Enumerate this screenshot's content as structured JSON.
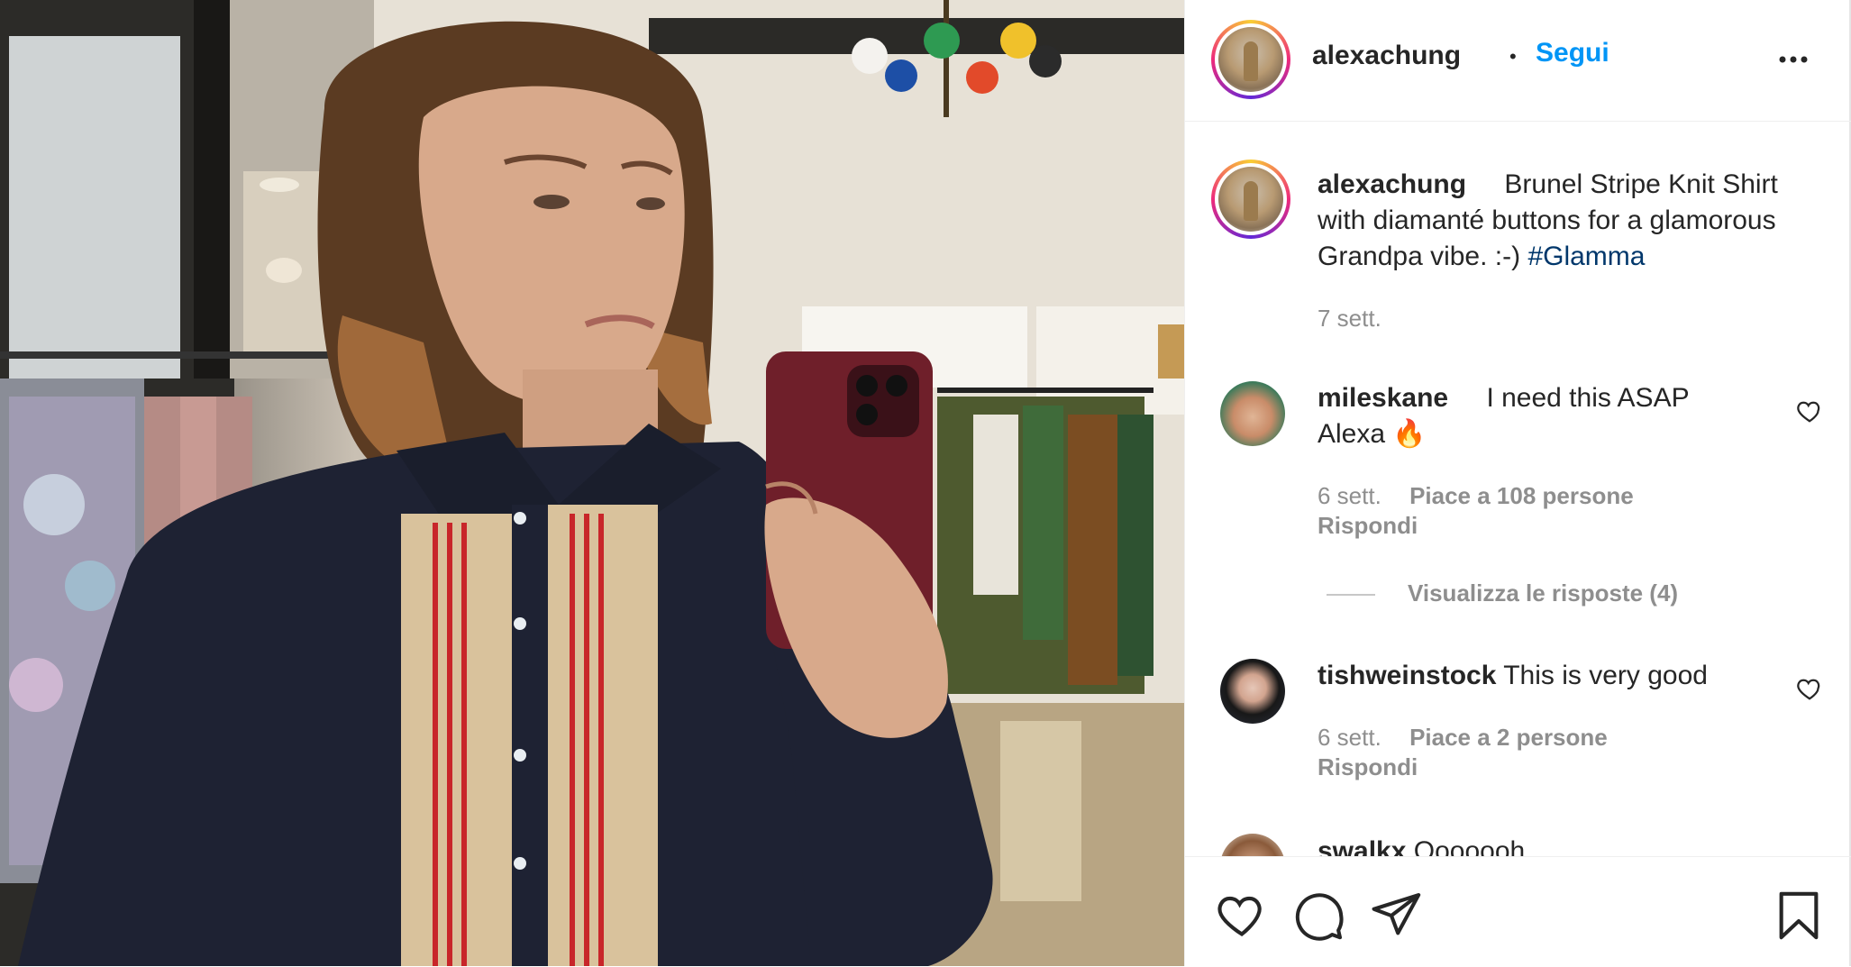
{
  "post": {
    "photo_alt": "",
    "colors": {
      "link": "#0095f6",
      "hashtag": "#00376b",
      "muted": "#8e8e8e",
      "text": "#262626"
    }
  },
  "header": {
    "username": "alexachung",
    "separator": "•",
    "follow_label": "Segui",
    "more_icon": "more-horizontal-icon"
  },
  "caption": {
    "username": "alexachung",
    "text_line1": "Brunel Stripe Knit Shirt",
    "text_line2": "with diamanté buttons for a glamorous",
    "text_line3": "Grandpa vibe. :-) ",
    "hashtag": "#Glamma",
    "time": "7 sett."
  },
  "comments": [
    {
      "username": "mileskane",
      "text_line1": "I need this ASAP",
      "text_line2": "Alexa 🔥",
      "time": "6 sett.",
      "likes": "Piace a 108 persone",
      "reply": "Rispondi",
      "view_replies": "Visualizza le risposte (4)"
    },
    {
      "username": "tishweinstock",
      "text_line1": "This is very good",
      "time": "6 sett.",
      "likes": "Piace a 2 persone",
      "reply": "Rispondi"
    },
    {
      "username": "swalkx",
      "text_line1": "Ooooooh"
    }
  ],
  "actions": [
    "heart-icon",
    "comment-icon",
    "share-icon",
    "bookmark-icon"
  ]
}
